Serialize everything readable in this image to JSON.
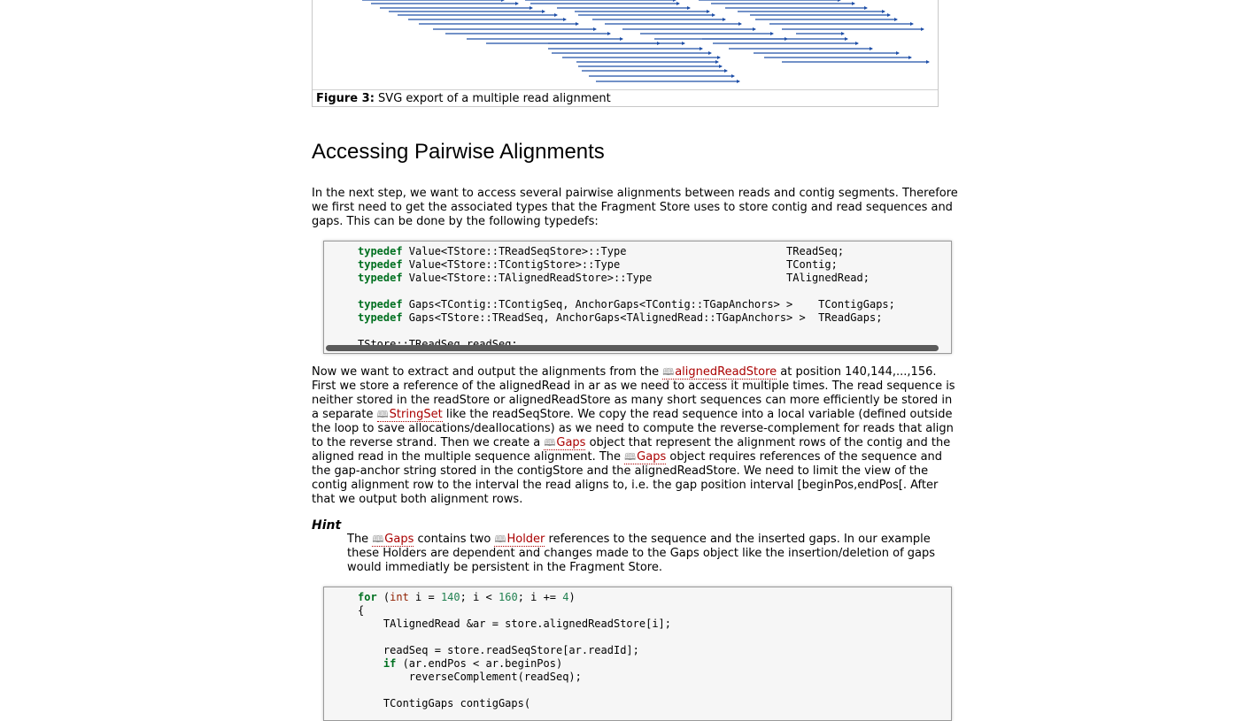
{
  "figure": {
    "caption_label": "Figure 3:",
    "caption_text": "SVG export of a multiple read alignment",
    "line_color": "#1f4fa8"
  },
  "heading": "Accessing Pairwise Alignments",
  "intro": "In the next step, we want to access several pairwise alignments between reads and contig segments. Therefore we first need to get the associated types that the Fragment Store uses to store contig and read sequences and gaps. This can be done by the following typedefs:",
  "code1_lines": [
    [
      [
        "typedef",
        "kw"
      ],
      [
        " Value<TStore::TReadSeqStore>::Type                         TReadSeq;",
        ""
      ]
    ],
    [
      [
        "typedef",
        "kw"
      ],
      [
        " Value<TStore::TContigStore>::Type                          TContig;",
        ""
      ]
    ],
    [
      [
        "typedef",
        "kw"
      ],
      [
        " Value<TStore::TAlignedReadStore>::Type                     TAlignedRead;",
        ""
      ]
    ],
    [
      [
        "",
        ""
      ]
    ],
    [
      [
        "typedef",
        "kw"
      ],
      [
        " Gaps<TContig::TContigSeq, AnchorGaps<TContig::TGapAnchors> >    TContigGaps;",
        ""
      ]
    ],
    [
      [
        "typedef",
        "kw"
      ],
      [
        " Gaps<TStore::TReadSeq, AnchorGaps<TAlignedRead::TGapAnchors> >  TReadGaps;",
        ""
      ]
    ],
    [
      [
        "",
        ""
      ]
    ],
    [
      [
        "TStore::TReadSeq readSeq;",
        ""
      ]
    ]
  ],
  "para2": {
    "s1": "Now we want to extract and output the alignments from the ",
    "l1": "alignedReadStore",
    "s2": " at position 140,144,...,156. First we store a reference of the alignedRead in ar as we need to access it multiple times. The read sequence is neither stored in the readStore or alignedReadStore as many short sequences can more efficiently be stored in a separate ",
    "l2": "StringSet",
    "s3": " like the readSeqStore. We copy the read sequence into a local variable (defined outside the loop to save allocations/deallocations) as we need to compute the reverse-complement for reads that align to the reverse strand. Then we create a ",
    "l3": "Gaps",
    "s4": " object that represent the alignment rows of the contig and the aligned read in the multiple sequence alignment. The ",
    "l4": "Gaps",
    "s5": " object requires references of the sequence and the gap-anchor string stored in the contigStore and the alignedReadStore. We need to limit the view of the contig alignment row to the interval the read aligns to, i.e. the gap position interval [beginPos,endPos[. After that we output both alignment rows."
  },
  "hint": {
    "title": "Hint",
    "s1": "The ",
    "l1": "Gaps",
    "s2": " contains two ",
    "l2": "Holder",
    "s3": " references to the sequence and the inserted gaps. In our example these Holders are dependent and changes made to the Gaps object like the insertion/deletion of gaps would immediatly be persistent in the Fragment Store."
  },
  "code2_lines": [
    [
      [
        "for",
        "kw"
      ],
      [
        " (",
        ""
      ],
      [
        "int",
        "ty"
      ],
      [
        " i = ",
        ""
      ],
      [
        "140",
        "nm"
      ],
      [
        "; i < ",
        ""
      ],
      [
        "160",
        "nm"
      ],
      [
        "; i += ",
        ""
      ],
      [
        "4",
        "nm"
      ],
      [
        ")",
        ""
      ]
    ],
    [
      [
        "{",
        ""
      ]
    ],
    [
      [
        "    TAlignedRead &ar = store.alignedReadStore[i];",
        ""
      ]
    ],
    [
      [
        "",
        ""
      ]
    ],
    [
      [
        "    readSeq = store.readSeqStore[ar.readId];",
        ""
      ]
    ],
    [
      [
        "    ",
        ""
      ],
      [
        "if",
        "kw"
      ],
      [
        " (ar.endPos < ar.beginPos)",
        ""
      ]
    ],
    [
      [
        "        reverseComplement(readSeq);",
        ""
      ]
    ],
    [
      [
        "",
        ""
      ]
    ],
    [
      [
        "    TContigGaps contigGaps(",
        ""
      ]
    ]
  ]
}
